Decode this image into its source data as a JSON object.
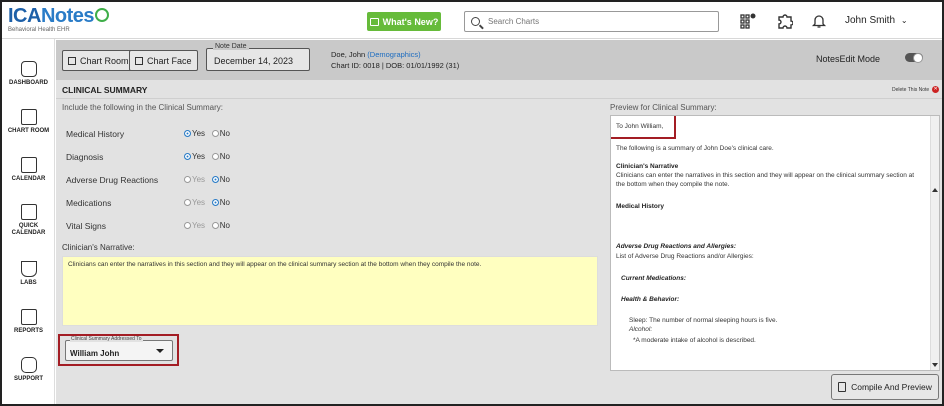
{
  "header": {
    "logo_text_ic": "ICA",
    "logo_text_notes": "Notes",
    "logo_subtitle": "Behavioral Health EHR",
    "whats_new": "What's New?",
    "search_placeholder": "Search Charts",
    "user_name": "John Smith"
  },
  "sidebar": {
    "items": [
      {
        "label": "DASHBOARD",
        "icon": "dashboard-icon"
      },
      {
        "label": "CHART ROOM",
        "icon": "chart-room-icon"
      },
      {
        "label": "CALENDAR",
        "icon": "calendar-icon"
      },
      {
        "label": "QUICK CALENDAR",
        "icon": "quick-calendar-icon"
      },
      {
        "label": "LABS",
        "icon": "flask-icon"
      },
      {
        "label": "REPORTS",
        "icon": "reports-icon"
      },
      {
        "label": "SUPPORT",
        "icon": "support-icon"
      }
    ]
  },
  "toolbar": {
    "chart_room": "Chart Room",
    "chart_face": "Chart Face",
    "note_date_label": "Note Date",
    "note_date_value": "December 14, 2023",
    "patient_name": "Doe, John",
    "demographics_link": "(Demographics)",
    "chart_info": "Chart ID: 0018 | DOB: 01/01/1992 (31)",
    "notes_edit_mode": "NotesEdit Mode"
  },
  "main": {
    "section_title": "CLINICAL SUMMARY",
    "delete_note": "Delete This Note",
    "include_label": "Include the following in the Clinical Summary:",
    "yes_label": "Yes",
    "no_label": "No",
    "rows": [
      {
        "label": "Medical History",
        "selected": "Yes"
      },
      {
        "label": "Diagnosis",
        "selected": "Yes"
      },
      {
        "label": "Adverse Drug Reactions",
        "selected": "No"
      },
      {
        "label": "Medications",
        "selected": "No"
      },
      {
        "label": "Vital Signs",
        "selected": "none"
      }
    ],
    "narrative_label": "Clinician's Narrative:",
    "narrative_text": "Clinicians can enter the narratives in this section and they will appear on the clinical summary section at the bottom when they compile the note.",
    "addressed_label": "Clinical Summary Addressed To",
    "addressed_value": "William John"
  },
  "preview": {
    "label": "Preview for Clinical Summary:",
    "to_line": "To John William,",
    "intro": "The following is a summary of John Doe's clinical care.",
    "narrative_heading": "Clinician's Narrative",
    "narrative_line1": "Clinicians can enter the narratives in this section and they will appear on the clinical summary section at",
    "narrative_line2": "the bottom when they compile the note.",
    "medical_history": "Medical History",
    "adr_heading": "Adverse Drug Reactions and Allergies:",
    "adr_text": "List of Adverse Drug Reactions and/or Allergies:",
    "current_meds": "Current Medications:",
    "health_behavior": "Health & Behavior:",
    "sleep_label": "Sleep:",
    "sleep_text": "The number of normal sleeping hours is five.",
    "alcohol_label": "Alcohol:",
    "alcohol_text": "*A moderate intake of alcohol is described."
  },
  "compile_button": "Compile And Preview"
}
